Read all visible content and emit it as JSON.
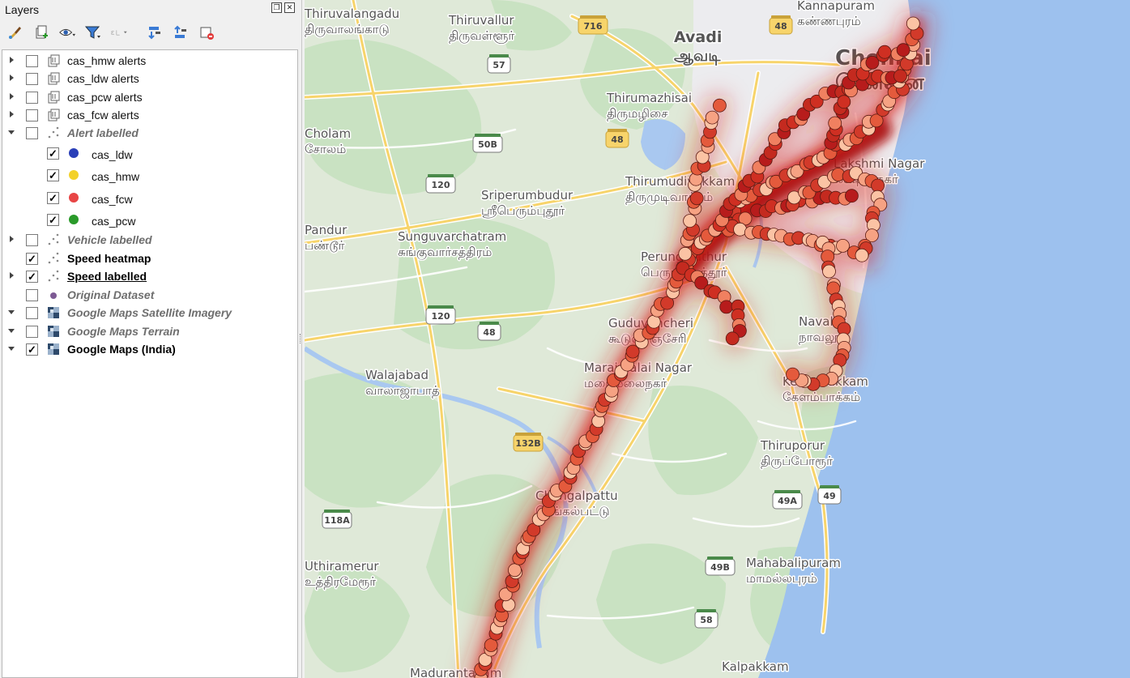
{
  "panel": {
    "title": "Layers",
    "restore_icon": "restore-window-icon",
    "close_icon": "close-window-icon",
    "toolbar": [
      {
        "name": "style-layer-button",
        "icon": "paintbrush-icon"
      },
      {
        "name": "add-group-button",
        "icon": "add-group-icon"
      },
      {
        "name": "visibility-button",
        "icon": "eye-icon"
      },
      {
        "name": "filter-legend-button",
        "icon": "filter-icon"
      },
      {
        "name": "filter-expression-button",
        "icon": "expression-filter-icon"
      },
      {
        "name": "expand-all-button",
        "icon": "expand-all-icon"
      },
      {
        "name": "collapse-all-button",
        "icon": "collapse-all-icon"
      },
      {
        "name": "remove-layer-button",
        "icon": "remove-layer-icon"
      }
    ]
  },
  "layers": [
    {
      "label": "cas_hmw alerts",
      "checked": false,
      "expanded": false,
      "indent": 0,
      "icon": "table-layer-icon",
      "style": "normal"
    },
    {
      "label": "cas_ldw alerts",
      "checked": false,
      "expanded": false,
      "indent": 0,
      "icon": "table-layer-icon",
      "style": "normal"
    },
    {
      "label": "cas_pcw alerts",
      "checked": false,
      "expanded": false,
      "indent": 0,
      "icon": "table-layer-icon",
      "style": "normal"
    },
    {
      "label": "cas_fcw alerts",
      "checked": false,
      "expanded": false,
      "indent": 0,
      "icon": "table-layer-icon",
      "style": "normal"
    },
    {
      "label": "Alert labelled",
      "checked": false,
      "expanded": true,
      "indent": 0,
      "icon": "point-layer-icon",
      "style": "group"
    },
    {
      "label": "cas_ldw",
      "checked": true,
      "indent": 1,
      "symbol_color": "#2a3fb8"
    },
    {
      "label": "cas_hmw",
      "checked": true,
      "indent": 1,
      "symbol_color": "#f3d12a"
    },
    {
      "label": "cas_fcw",
      "checked": true,
      "indent": 1,
      "symbol_color": "#e84545"
    },
    {
      "label": "cas_pcw",
      "checked": true,
      "indent": 1,
      "symbol_color": "#2a9a2a"
    },
    {
      "label": "Vehicle labelled",
      "checked": false,
      "expanded": false,
      "indent": 0,
      "icon": "point-layer-icon",
      "style": "group"
    },
    {
      "label": "Speed heatmap",
      "checked": true,
      "expanded": null,
      "indent": 0,
      "icon": "point-layer-icon",
      "style": "bold"
    },
    {
      "label": "Speed labelled",
      "checked": true,
      "expanded": false,
      "indent": 0,
      "icon": "point-layer-icon",
      "style": "bold-underline"
    },
    {
      "label": "Original Dataset",
      "checked": false,
      "expanded": null,
      "indent": 0,
      "icon": "purple-point-icon",
      "style": "group"
    },
    {
      "label": "Google Maps Satellite Imagery",
      "checked": false,
      "expanded": true,
      "indent": 0,
      "icon": "raster-layer-icon",
      "style": "group"
    },
    {
      "label": "Google Maps Terrain",
      "checked": false,
      "expanded": true,
      "indent": 0,
      "icon": "raster-layer-icon",
      "style": "group"
    },
    {
      "label": "Google Maps (India)",
      "checked": true,
      "expanded": true,
      "indent": 0,
      "icon": "raster-layer-icon",
      "style": "bold"
    }
  ],
  "map": {
    "colors": {
      "land": "#dfe9d8",
      "green": "#c8e3c5",
      "urban": "#ebebef",
      "sea": "#9dc1ee",
      "water": "#a9c8f0",
      "road": "#f7d46b",
      "heat": "#d8231c"
    },
    "places": [
      {
        "en": "Thiruvalangadu",
        "ta": "திருவாலங்காடு"
      },
      {
        "en": "Thiruvallur",
        "ta": "திருவள்ளூர்"
      },
      {
        "en": "Avadi",
        "ta": "ஆவடி"
      },
      {
        "en": "Chennai",
        "ta": "சென்னை"
      },
      {
        "en": "Thirumazhisai",
        "ta": "திருமழிசை"
      },
      {
        "en": "Sriperumbudur",
        "ta": "ஸ்ரீபெரும்புதூர்"
      },
      {
        "en": "Thirumudivakkam",
        "ta": "திருமுடிவாக்கம்"
      },
      {
        "en": "Sunguvarchatram",
        "ta": "சுங்குவார்சத்திரம்"
      },
      {
        "en": "Perungalathur",
        "ta": "பெருங்களத்தூர்"
      },
      {
        "en": "Guduvancheri",
        "ta": "கூடுவாஞ்சேரி"
      },
      {
        "en": "Maraimalai Nagar",
        "ta": "மறைமலைநகர்"
      },
      {
        "en": "Walajabad",
        "ta": "வாலாஜாபாத்"
      },
      {
        "en": "Navalur",
        "ta": "நாவலூர்"
      },
      {
        "en": "Kelambakkam",
        "ta": "கேளம்பாக்கம்"
      },
      {
        "en": "Thiruporur",
        "ta": "திருப்போரூர்"
      },
      {
        "en": "Chengalpattu",
        "ta": "செங்கல்பட்டு"
      },
      {
        "en": "Mahabalipuram",
        "ta": "மாமல்லபுரம்"
      },
      {
        "en": "Kalpakkam",
        "ta": ""
      },
      {
        "en": "Lakshmi Nagar",
        "ta": "லக்ஷ்மி நகர்"
      },
      {
        "en": "Kannapuram",
        "ta": "கண்ணபுரம்"
      },
      {
        "en": "Cholam",
        "ta": "சோலம்"
      },
      {
        "en": "Pandur",
        "ta": "பண்டூர்"
      },
      {
        "en": "Uthiramerur",
        "ta": "உத்திரமேரூர்"
      },
      {
        "en": "Madurantakam",
        "ta": ""
      }
    ],
    "shields": [
      "716",
      "48",
      "57",
      "50B",
      "48",
      "120",
      "120",
      "48",
      "132B",
      "118A",
      "49A",
      "49",
      "49B",
      "58"
    ]
  }
}
